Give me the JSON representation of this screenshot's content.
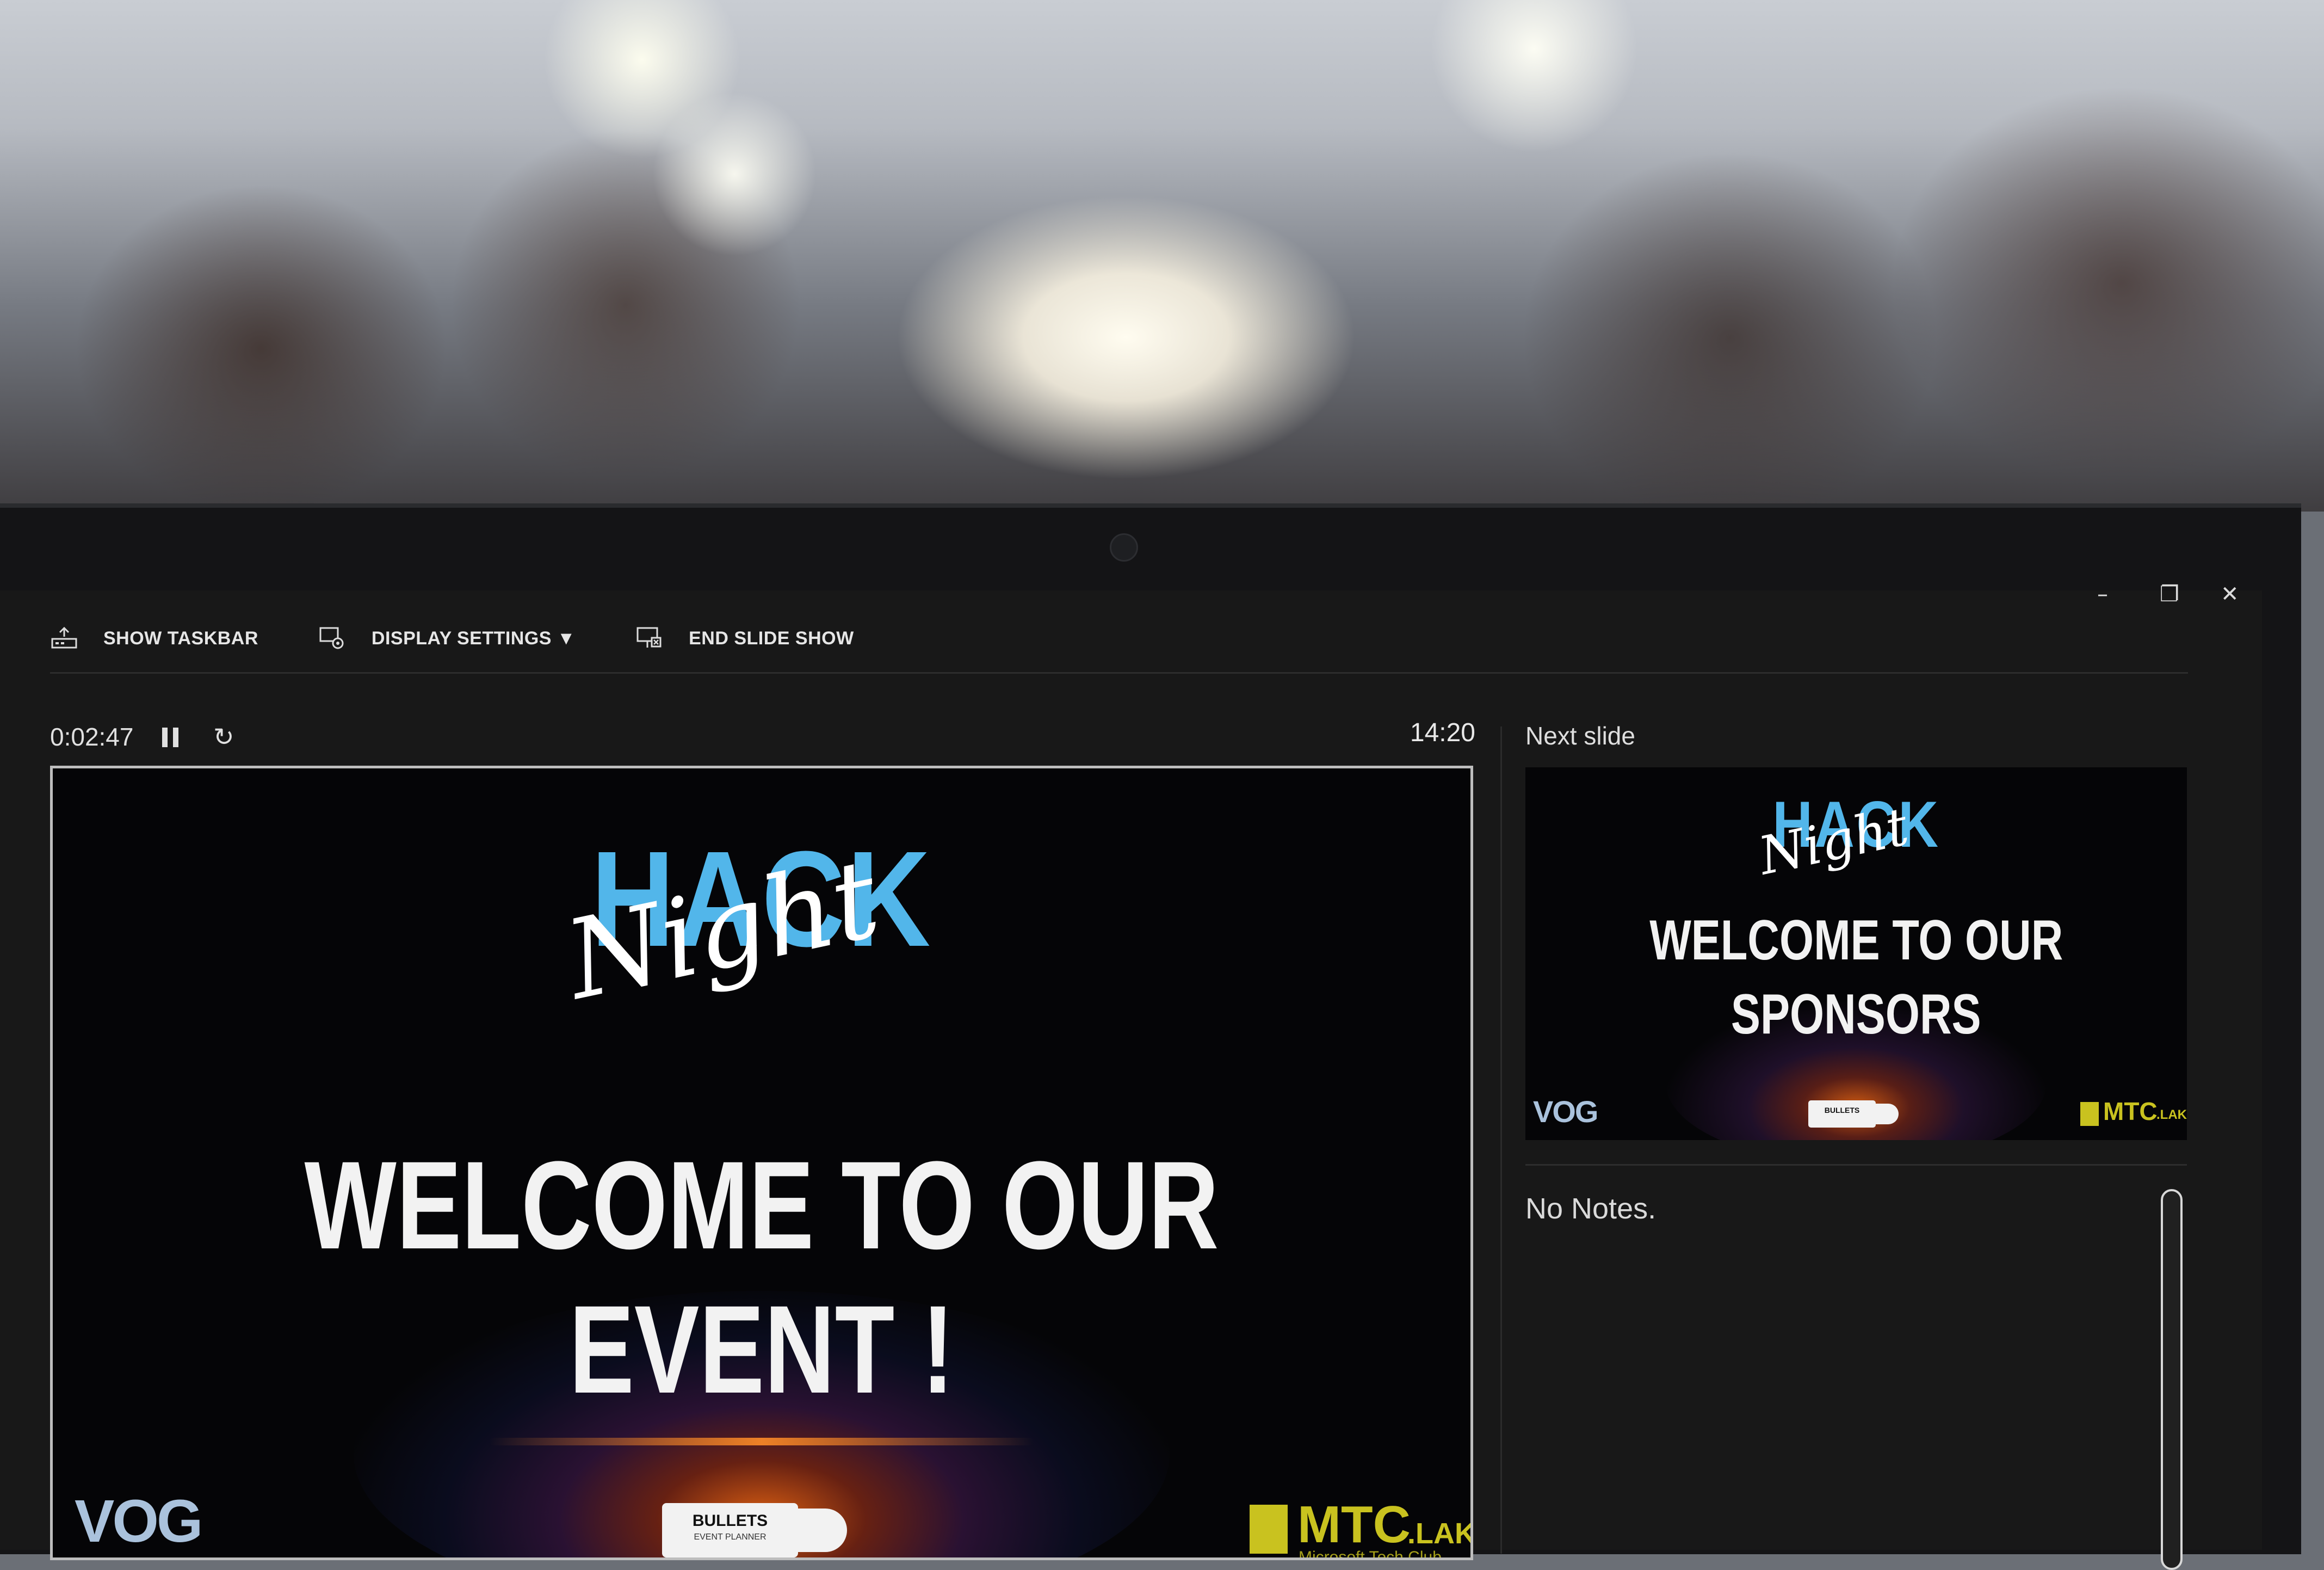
{
  "toolbar": {
    "show_taskbar": "SHOW TASKBAR",
    "display_settings": "DISPLAY SETTINGS ▼",
    "end_slide_show": "END SLIDE SHOW"
  },
  "window_controls": {
    "minimize": "–",
    "restore": "❐",
    "close": "✕"
  },
  "presenter": {
    "elapsed_time": "0:02:47",
    "clock": "14:20",
    "next_slide_label": "Next slide",
    "notes": "No Notes."
  },
  "current_slide": {
    "logo_hack": "HACK",
    "logo_night": "Night",
    "headline": "WELCOME TO OUR EVENT !",
    "footer_left": "VOG",
    "footer_center": "BULLETS",
    "footer_center_sub": "EVENT PLANNER",
    "footer_right": "MTC",
    "footer_right_suffix": ".LAKC",
    "footer_right_sub": "Microsoft Tech Club"
  },
  "next_slide": {
    "logo_hack": "HACK",
    "logo_night": "Night",
    "headline_line1": "WELCOME TO OUR",
    "headline_line2": "SPONSORS",
    "footer_left": "VOG",
    "footer_center": "BULLETS",
    "footer_right": "MTC",
    "footer_right_suffix": ".LAKC"
  },
  "colors": {
    "accent_blue": "#52b6ea",
    "mtc_yellow": "#c9c21f",
    "screen_bg": "#181818"
  }
}
